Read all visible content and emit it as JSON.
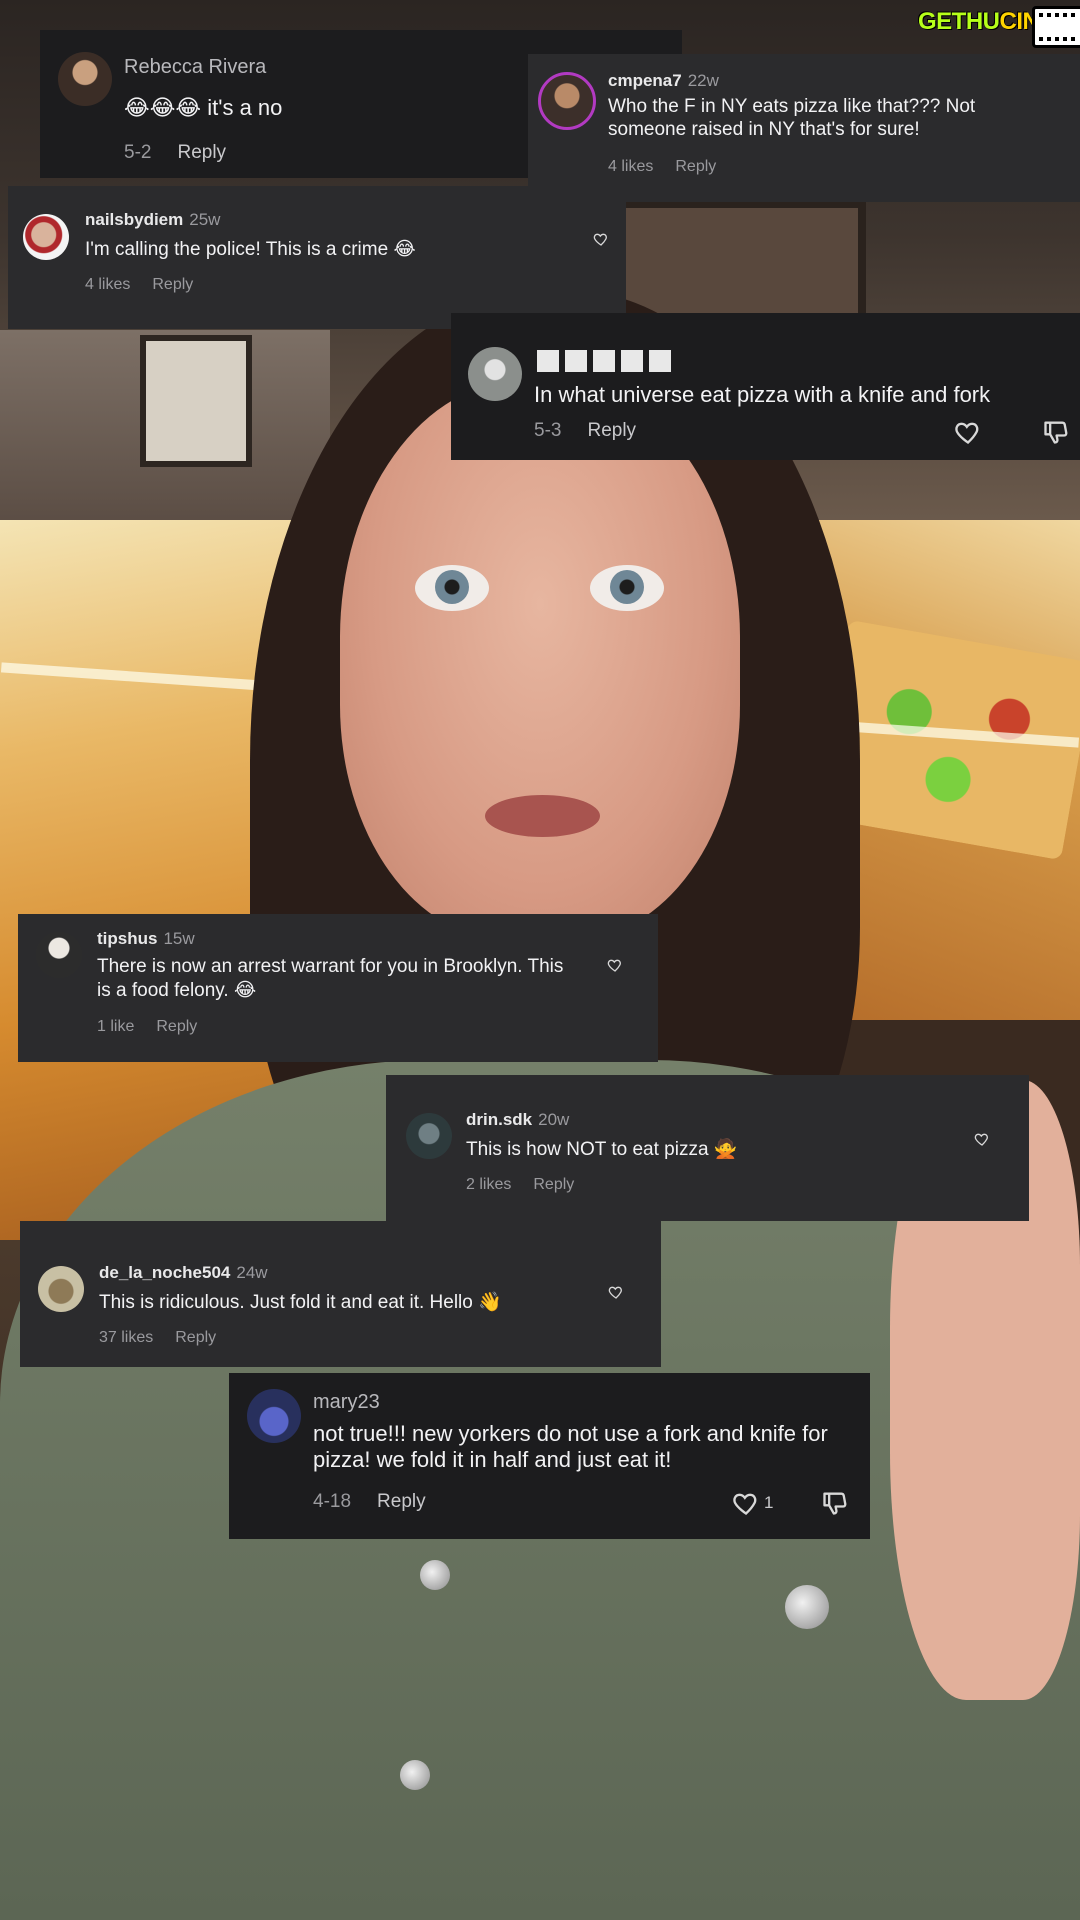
{
  "watermark": {
    "brand_a": "GETHU",
    "brand_b": "CINEMA"
  },
  "comments": [
    {
      "id": "c1",
      "user": "Rebecca Rivera",
      "emoji": "😂😂😂",
      "text": "it's a no",
      "date": "5-2",
      "reply": "Reply"
    },
    {
      "id": "c2",
      "user": "cmpena7",
      "time": "22w",
      "text": "Who the F in NY eats pizza like that??? Not someone raised in NY that's for sure!",
      "likes": "4 likes",
      "reply": "Reply"
    },
    {
      "id": "c3",
      "user": "nailsbydiem",
      "time": "25w",
      "text": "I'm calling the police! This is a crime",
      "emoji": "😂",
      "likes": "4 likes",
      "reply": "Reply"
    },
    {
      "id": "c4",
      "user_redacted": "█████",
      "text": "In what universe eat pizza with a knife and fork",
      "date": "5-3",
      "reply": "Reply"
    },
    {
      "id": "c5",
      "user": "tipshus",
      "time": "15w",
      "text": "There is now an arrest warrant for you in Brooklyn. This is a food felony.",
      "emoji": "😂",
      "likes": "1 like",
      "reply": "Reply"
    },
    {
      "id": "c6",
      "user": "drin.sdk",
      "time": "20w",
      "text": "This is how NOT to eat pizza",
      "emoji": "🙅",
      "likes": "2 likes",
      "reply": "Reply"
    },
    {
      "id": "c7",
      "user": "de_la_noche504",
      "time": "24w",
      "text": "This is ridiculous. Just fold it and eat it. Hello",
      "emoji": "👋",
      "likes": "37 likes",
      "reply": "Reply"
    },
    {
      "id": "c8",
      "user": "mary23",
      "text": "not true!!! new yorkers do not use a fork and knife for pizza! we fold it in half and just eat it!",
      "date": "4-18",
      "reply": "Reply",
      "like_count": "1"
    }
  ],
  "colors": {
    "card_bg": "#2b2b2d",
    "card_dark_bg": "#1c1c1e",
    "watermark_green": "#b6ff1a",
    "watermark_yellow": "#ffd400"
  }
}
